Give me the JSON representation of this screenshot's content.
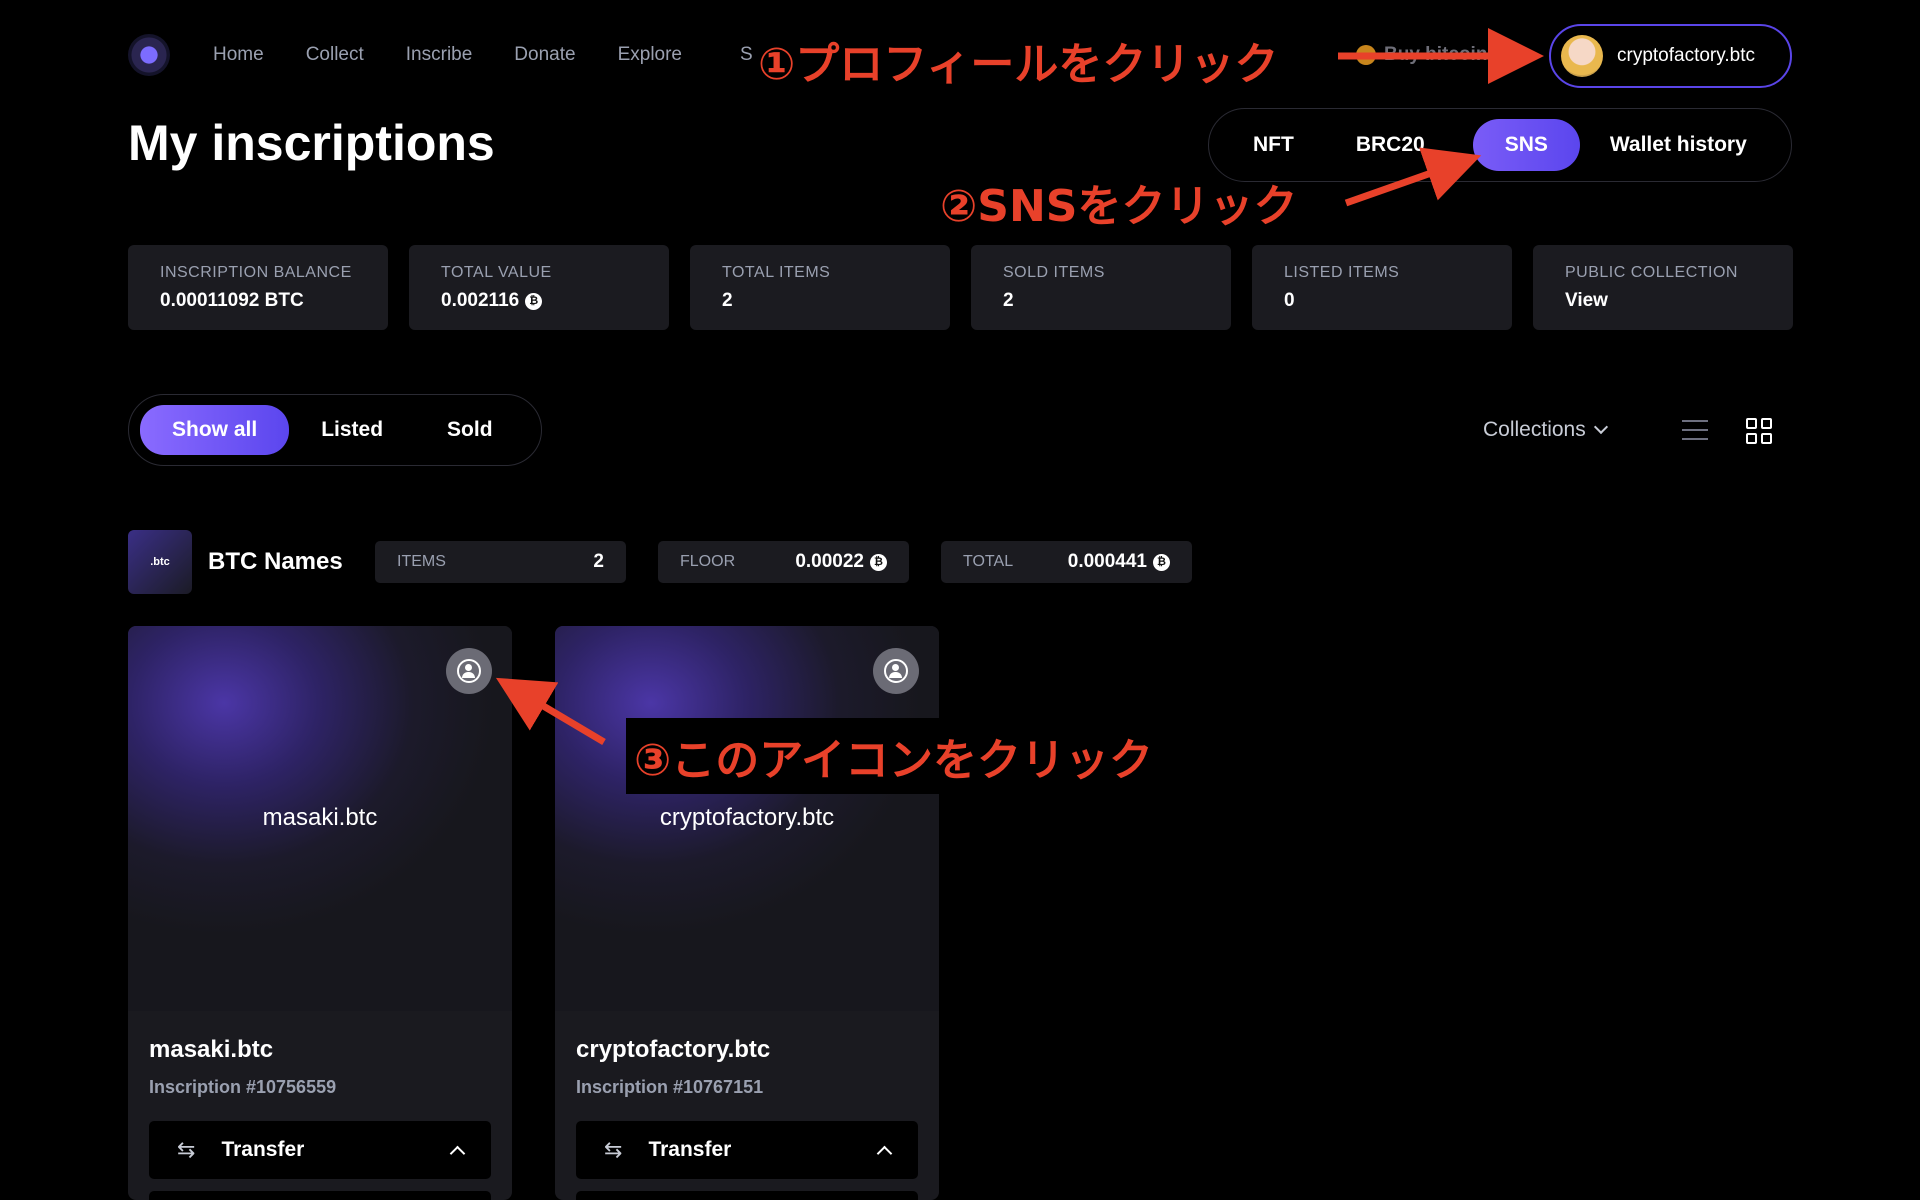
{
  "nav": {
    "items": [
      "Home",
      "Collect",
      "Inscribe",
      "Donate",
      "Explore"
    ],
    "trail": "S",
    "buy_label": "Buy bitcoin",
    "profile_name": "cryptofactory.btc"
  },
  "page": {
    "title": "My inscriptions",
    "tabs": [
      {
        "label": "NFT",
        "active": false
      },
      {
        "label": "BRC20",
        "active": false
      },
      {
        "label": "SNS",
        "active": true
      },
      {
        "label": "Wallet history",
        "active": false
      }
    ]
  },
  "stats": [
    {
      "label": "INSCRIPTION BALANCE",
      "value": "0.00011092 BTC",
      "btc_icon": false
    },
    {
      "label": "TOTAL VALUE",
      "value": "0.002116",
      "btc_icon": true
    },
    {
      "label": "TOTAL ITEMS",
      "value": "2",
      "btc_icon": false
    },
    {
      "label": "SOLD ITEMS",
      "value": "2",
      "btc_icon": false
    },
    {
      "label": "LISTED ITEMS",
      "value": "0",
      "btc_icon": false
    },
    {
      "label": "PUBLIC COLLECTION",
      "value": "View",
      "btc_icon": false
    }
  ],
  "filters": {
    "items": [
      "Show all",
      "Listed",
      "Sold"
    ],
    "active": "Show all",
    "collections_label": "Collections"
  },
  "collection": {
    "thumb_text": ".btc",
    "name": "BTC Names",
    "items_label": "ITEMS",
    "items_value": "2",
    "floor_label": "FLOOR",
    "floor_value": "0.00022",
    "total_label": "TOTAL",
    "total_value": "0.000441"
  },
  "cards": [
    {
      "art_name": "masaki.btc",
      "name": "masaki.btc",
      "inscription": "Inscription #10756559",
      "action": "Transfer"
    },
    {
      "art_name": "cryptofactory.btc",
      "name": "cryptofactory.btc",
      "inscription": "Inscription #10767151",
      "action": "Transfer"
    }
  ],
  "annotations": {
    "step1": "①プロフィールをクリック",
    "step2": "②SNSをクリック",
    "step3": "③このアイコンをクリック"
  },
  "colors": {
    "accent": "#6c52f5",
    "annotation": "#e8412a",
    "background": "#000000",
    "card": "#1b1b20"
  }
}
